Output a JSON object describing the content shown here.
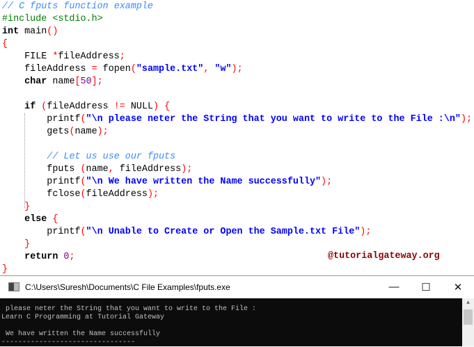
{
  "code_lines": [
    [
      [
        "c",
        "// C fputs function example"
      ]
    ],
    [
      [
        "p",
        "#include <stdio.h>"
      ]
    ],
    [
      [
        "k",
        "int"
      ],
      [
        "t",
        " main"
      ],
      [
        "o",
        "()"
      ]
    ],
    [
      [
        "o",
        "{"
      ]
    ],
    [
      [
        "t",
        "    FILE "
      ],
      [
        "o",
        "*"
      ],
      [
        "t",
        "fileAddress"
      ],
      [
        "o",
        ";"
      ]
    ],
    [
      [
        "t",
        "    fileAddress "
      ],
      [
        "o",
        "="
      ],
      [
        "t",
        " fopen"
      ],
      [
        "o",
        "("
      ],
      [
        "s",
        "\"sample.txt\""
      ],
      [
        "o",
        ","
      ],
      [
        "t",
        " "
      ],
      [
        "s",
        "\"w\""
      ],
      [
        "o",
        ");"
      ]
    ],
    [
      [
        "t",
        "    "
      ],
      [
        "k",
        "char"
      ],
      [
        "t",
        " name"
      ],
      [
        "o",
        "["
      ],
      [
        "n",
        "50"
      ],
      [
        "o",
        "];"
      ]
    ],
    [],
    [
      [
        "t",
        "    "
      ],
      [
        "k",
        "if"
      ],
      [
        "t",
        " "
      ],
      [
        "o",
        "("
      ],
      [
        "t",
        "fileAddress "
      ],
      [
        "o",
        "!="
      ],
      [
        "t",
        " NULL"
      ],
      [
        "o",
        ")"
      ],
      [
        "t",
        " "
      ],
      [
        "o",
        "{"
      ]
    ],
    [
      [
        "t",
        "        printf"
      ],
      [
        "o",
        "("
      ],
      [
        "s",
        "\"\\n please neter the String that you want to write to the File :\\n\""
      ],
      [
        "o",
        ");"
      ]
    ],
    [
      [
        "t",
        "        gets"
      ],
      [
        "o",
        "("
      ],
      [
        "t",
        "name"
      ],
      [
        "o",
        ");"
      ]
    ],
    [],
    [
      [
        "t",
        "        "
      ],
      [
        "c",
        "// Let us use our fputs"
      ]
    ],
    [
      [
        "t",
        "        fputs "
      ],
      [
        "o",
        "("
      ],
      [
        "t",
        "name"
      ],
      [
        "o",
        ","
      ],
      [
        "t",
        " fileAddress"
      ],
      [
        "o",
        ");"
      ]
    ],
    [
      [
        "t",
        "        printf"
      ],
      [
        "o",
        "("
      ],
      [
        "s",
        "\"\\n We have written the Name successfully\""
      ],
      [
        "o",
        ");"
      ]
    ],
    [
      [
        "t",
        "        fclose"
      ],
      [
        "o",
        "("
      ],
      [
        "t",
        "fileAddress"
      ],
      [
        "o",
        ");"
      ]
    ],
    [
      [
        "t",
        "    "
      ],
      [
        "o",
        "}"
      ]
    ],
    [
      [
        "t",
        "    "
      ],
      [
        "k",
        "else"
      ],
      [
        "t",
        " "
      ],
      [
        "o",
        "{"
      ]
    ],
    [
      [
        "t",
        "        printf"
      ],
      [
        "o",
        "("
      ],
      [
        "s",
        "\"\\n Unable to Create or Open the Sample.txt File\""
      ],
      [
        "o",
        ");"
      ]
    ],
    [
      [
        "t",
        "    "
      ],
      [
        "o",
        "}"
      ]
    ],
    [
      [
        "t",
        "    "
      ],
      [
        "k",
        "return"
      ],
      [
        "t",
        " "
      ],
      [
        "n",
        "0"
      ],
      [
        "o",
        ";"
      ]
    ],
    [
      [
        "o",
        "}"
      ]
    ]
  ],
  "watermark": "@tutorialgateway.org",
  "console": {
    "title": "C:\\Users\\Suresh\\Documents\\C File Examples\\fputs.exe",
    "minimize": "—",
    "maximize": "☐",
    "close": "✕",
    "output": [
      " please neter the String that you want to write to the File :",
      "Learn C Programming at Tutorial Gateway",
      "",
      " We have written the Name successfully",
      "--------------------------------"
    ]
  }
}
